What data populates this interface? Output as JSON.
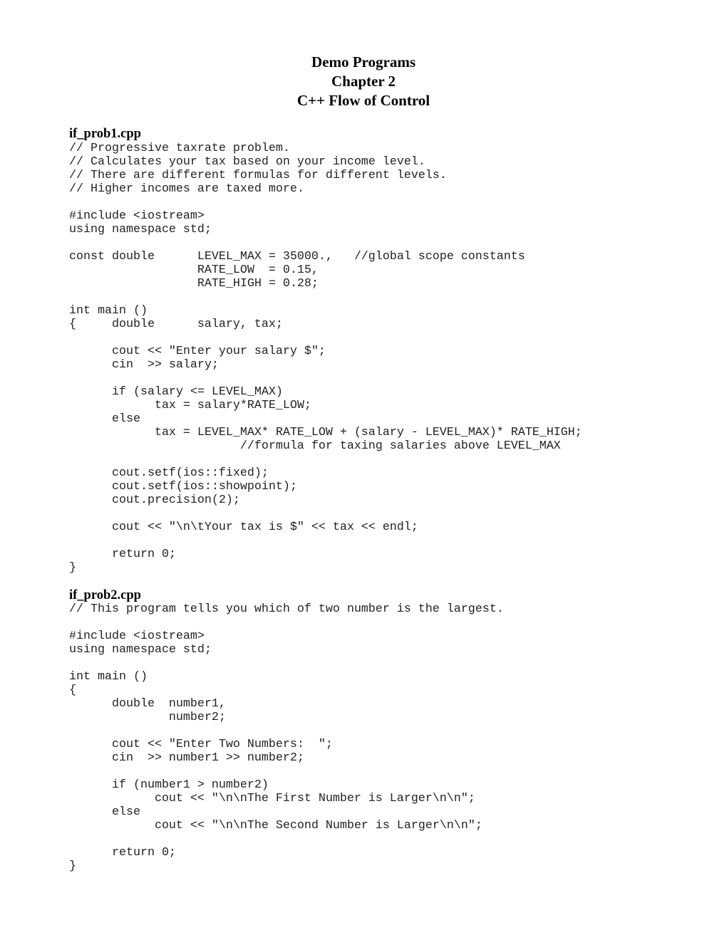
{
  "document": {
    "title_lines": [
      "Demo Programs",
      "Chapter 2",
      "C++ Flow of Control"
    ],
    "programs": [
      {
        "filename": "if_prob1.cpp",
        "code_lines": [
          "// Progressive taxrate problem.",
          "// Calculates your tax based on your income level.",
          "// There are different formulas for different levels.",
          "// Higher incomes are taxed more.",
          "",
          "#include <iostream>",
          "using namespace std;",
          "",
          "const double      LEVEL_MAX = 35000.,   //global scope constants",
          "                  RATE_LOW  = 0.15,",
          "                  RATE_HIGH = 0.28;",
          "",
          "int main ()",
          "{     double      salary, tax;",
          "",
          "      cout << \"Enter your salary $\";",
          "      cin  >> salary;",
          "",
          "      if (salary <= LEVEL_MAX)",
          "            tax = salary*RATE_LOW;",
          "      else",
          "            tax = LEVEL_MAX* RATE_LOW + (salary - LEVEL_MAX)* RATE_HIGH;",
          "                        //formula for taxing salaries above LEVEL_MAX",
          "",
          "      cout.setf(ios::fixed);",
          "      cout.setf(ios::showpoint);",
          "      cout.precision(2);",
          "",
          "      cout << \"\\n\\tYour tax is $\" << tax << endl;",
          "",
          "      return 0;",
          "}"
        ]
      },
      {
        "filename": "if_prob2.cpp",
        "code_lines": [
          "// This program tells you which of two number is the largest.",
          "",
          "#include <iostream>",
          "using namespace std;",
          "",
          "int main ()",
          "{",
          "      double  number1,",
          "              number2;",
          "",
          "      cout << \"Enter Two Numbers:  \";",
          "      cin  >> number1 >> number2;",
          "",
          "      if (number1 > number2)",
          "            cout << \"\\n\\nThe First Number is Larger\\n\\n\";",
          "      else",
          "            cout << \"\\n\\nThe Second Number is Larger\\n\\n\";",
          "",
          "      return 0;",
          "}"
        ]
      }
    ]
  }
}
